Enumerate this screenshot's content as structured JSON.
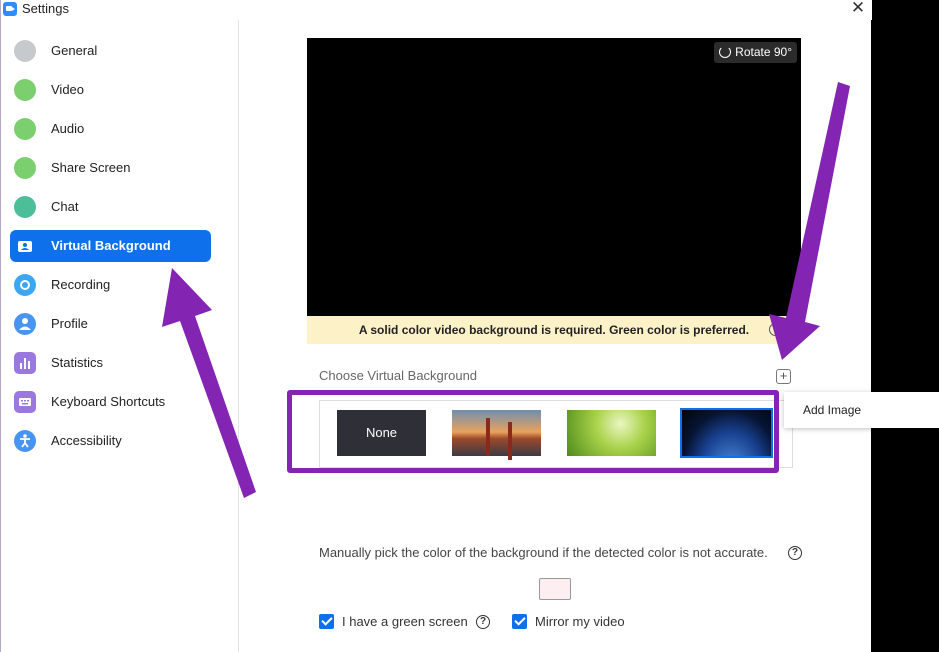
{
  "window": {
    "title": "Settings",
    "close_glyph": "✕"
  },
  "sidebar": {
    "items": [
      {
        "label": "General",
        "icon": "gear-icon",
        "color": "#9aa0a6"
      },
      {
        "label": "Video",
        "icon": "video-camera-icon",
        "color": "#6cc25f"
      },
      {
        "label": "Audio",
        "icon": "headphones-icon",
        "color": "#6cc25f"
      },
      {
        "label": "Share Screen",
        "icon": "share-screen-icon",
        "color": "#6cc25f"
      },
      {
        "label": "Chat",
        "icon": "chat-bubble-icon",
        "color": "#3fb18f"
      },
      {
        "label": "Virtual Background",
        "icon": "virtual-background-icon",
        "color": "#ffffff",
        "active": true
      },
      {
        "label": "Recording",
        "icon": "record-icon",
        "color": "#2d9cef"
      },
      {
        "label": "Profile",
        "icon": "profile-icon",
        "color": "#3d8ef0"
      },
      {
        "label": "Statistics",
        "icon": "statistics-icon",
        "color": "#8e6ad8"
      },
      {
        "label": "Keyboard Shortcuts",
        "icon": "keyboard-icon",
        "color": "#8e6ad8"
      },
      {
        "label": "Accessibility",
        "icon": "accessibility-icon",
        "color": "#3d8ef0"
      }
    ]
  },
  "preview": {
    "rotate_label": "Rotate 90°",
    "notice": "A solid color video background is required. Green color is preferred."
  },
  "backgrounds": {
    "heading": "Choose Virtual Background",
    "add_symbol": "+",
    "add_popup_label": "Add Image",
    "items": [
      {
        "label": "None"
      },
      {
        "name": "golden-gate-bridge"
      },
      {
        "name": "grass"
      },
      {
        "name": "earth-from-space",
        "selected": true
      }
    ]
  },
  "manual": {
    "text": "Manually pick the color of the background if the detected color is not accurate.",
    "help_glyph": "?",
    "swatch_color": "#fdeef2"
  },
  "options": {
    "green_screen_label": "I have a green screen",
    "green_screen_checked": true,
    "mirror_label": "Mirror my video",
    "mirror_checked": true
  },
  "annotation_color": "#8424b3"
}
